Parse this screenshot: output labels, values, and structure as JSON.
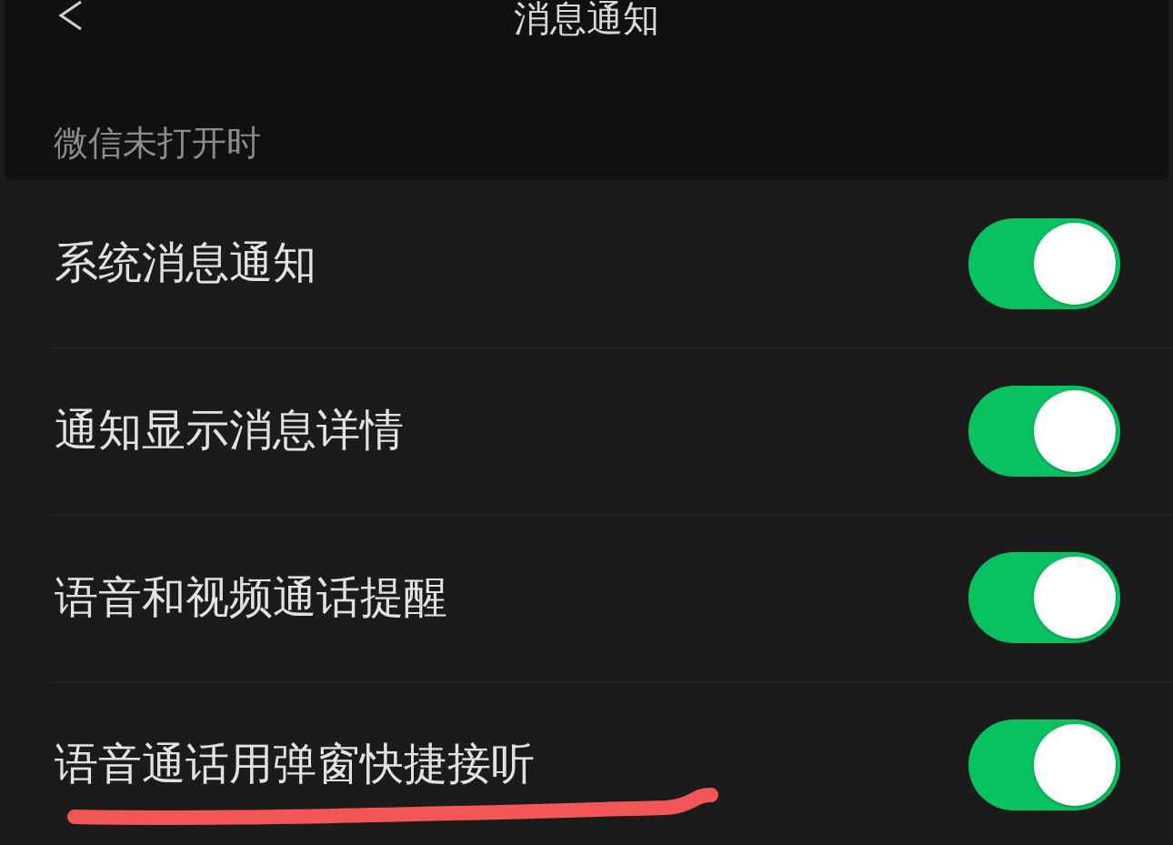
{
  "nav_bar": {
    "title": "消息通知"
  },
  "section": {
    "title": "微信未打开时"
  },
  "rows": [
    {
      "label": "系统消息通知",
      "on": true,
      "underlined": false
    },
    {
      "label": "通知显示消息详情",
      "on": true,
      "underlined": false
    },
    {
      "label": "语音和视频通话提醒",
      "on": true,
      "underlined": false
    },
    {
      "label": "语音通话用弹窗快捷接听",
      "on": true,
      "underlined": true
    }
  ]
}
